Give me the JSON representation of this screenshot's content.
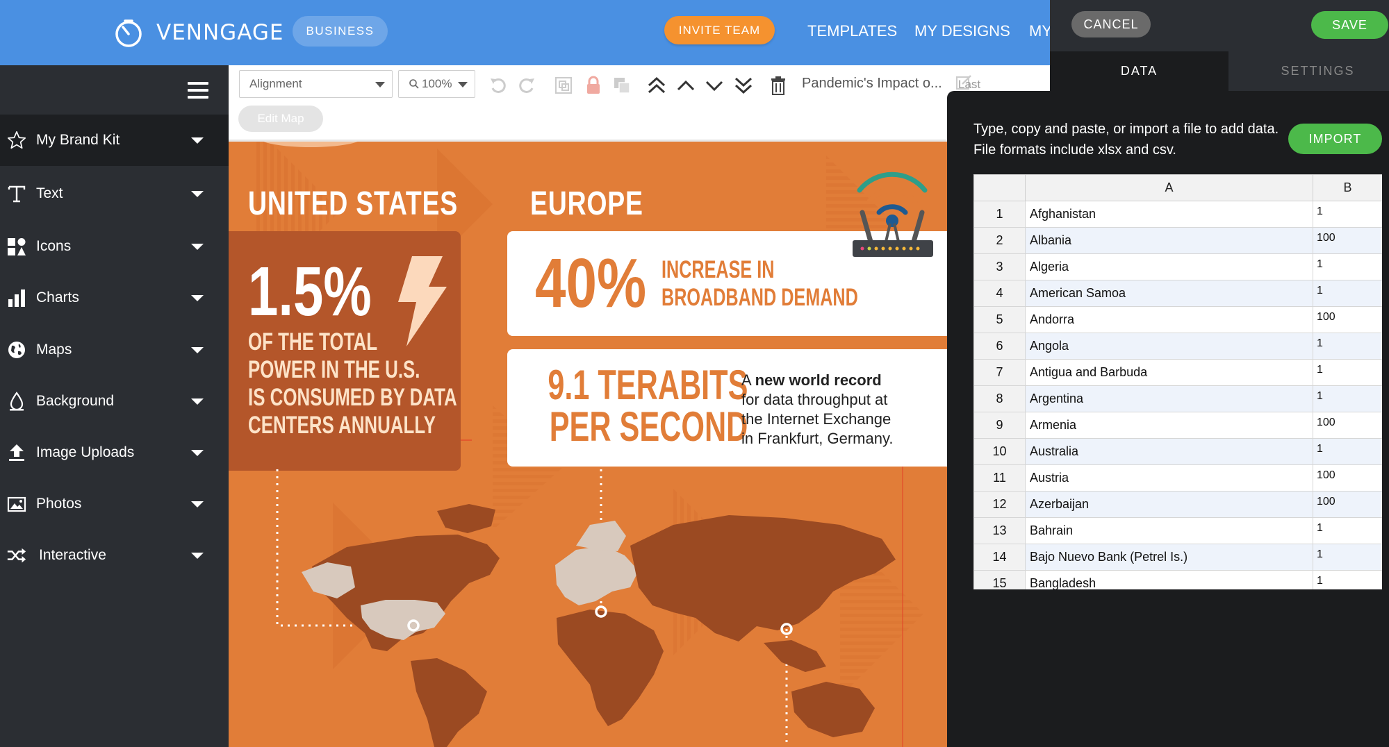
{
  "app": {
    "brand": "VENNGAGE",
    "plan_badge": "BUSINESS",
    "invite_button": "INVITE TEAM",
    "nav": [
      "TEMPLATES",
      "MY DESIGNS",
      "MY"
    ]
  },
  "sidebar": {
    "items": [
      {
        "label": "My Brand Kit",
        "icon": "star-icon"
      },
      {
        "label": "Text",
        "icon": "text-icon"
      },
      {
        "label": "Icons",
        "icon": "icons-grid-icon"
      },
      {
        "label": "Charts",
        "icon": "bar-chart-icon"
      },
      {
        "label": "Maps",
        "icon": "globe-icon"
      },
      {
        "label": "Background",
        "icon": "droplet-icon"
      },
      {
        "label": "Image Uploads",
        "icon": "upload-icon"
      },
      {
        "label": "Photos",
        "icon": "photo-icon"
      },
      {
        "label": "Interactive",
        "icon": "shuffle-icon"
      }
    ]
  },
  "toolbar": {
    "alignment": "Alignment",
    "zoom": "100%",
    "edit_map": "Edit Map",
    "doc_title": "Pandemic's Impact o...",
    "last": "Last"
  },
  "canvas": {
    "us_heading": "UNITED STATES",
    "eu_heading": "EUROPE",
    "us_stat": "1.5%",
    "us_lines": [
      "OF THE TOTAL",
      "POWER IN THE U.S.",
      "IS CONSUMED BY DATA",
      "CENTERS ANNUALLY"
    ],
    "eu_stat": "40%",
    "eu_lines": [
      "INCREASE IN",
      "BROADBAND DEMAND"
    ],
    "tera_lines": [
      "9.1 TERABITS",
      "PER SECOND"
    ],
    "record_prefix": "A ",
    "record_bold": "new world record",
    "record_lines": [
      "for data throughput at",
      "the Internet Exchange",
      "in Frankfurt, Germany."
    ]
  },
  "panel": {
    "cancel": "CANCEL",
    "save": "SAVE",
    "tab_data": "DATA",
    "tab_settings": "SETTINGS",
    "info_lines": [
      "Type, copy and paste, or import a file to add data.",
      "File formats include xlsx and csv."
    ],
    "import": "IMPORT",
    "columns": [
      "A",
      "B"
    ],
    "rows": [
      {
        "n": "1",
        "name": "Afghanistan",
        "val": "1"
      },
      {
        "n": "2",
        "name": "Albania",
        "val": "100"
      },
      {
        "n": "3",
        "name": "Algeria",
        "val": "1"
      },
      {
        "n": "4",
        "name": "American Samoa",
        "val": "1"
      },
      {
        "n": "5",
        "name": "Andorra",
        "val": "100"
      },
      {
        "n": "6",
        "name": "Angola",
        "val": "1"
      },
      {
        "n": "7",
        "name": "Antigua and Barbuda",
        "val": "1"
      },
      {
        "n": "8",
        "name": "Argentina",
        "val": "1"
      },
      {
        "n": "9",
        "name": "Armenia",
        "val": "100"
      },
      {
        "n": "10",
        "name": "Australia",
        "val": "1"
      },
      {
        "n": "11",
        "name": "Austria",
        "val": "100"
      },
      {
        "n": "12",
        "name": "Azerbaijan",
        "val": "100"
      },
      {
        "n": "13",
        "name": "Bahrain",
        "val": "1"
      },
      {
        "n": "14",
        "name": "Bajo Nuevo Bank (Petrel Is.)",
        "val": "1"
      },
      {
        "n": "15",
        "name": "Bangladesh",
        "val": "1"
      }
    ]
  },
  "colors": {
    "topbar": "#4a90e2",
    "canvas_orange": "#e17d38",
    "card_brown": "#b4562a",
    "save_green": "#4cb94a",
    "invite_orange": "#f5922f"
  }
}
